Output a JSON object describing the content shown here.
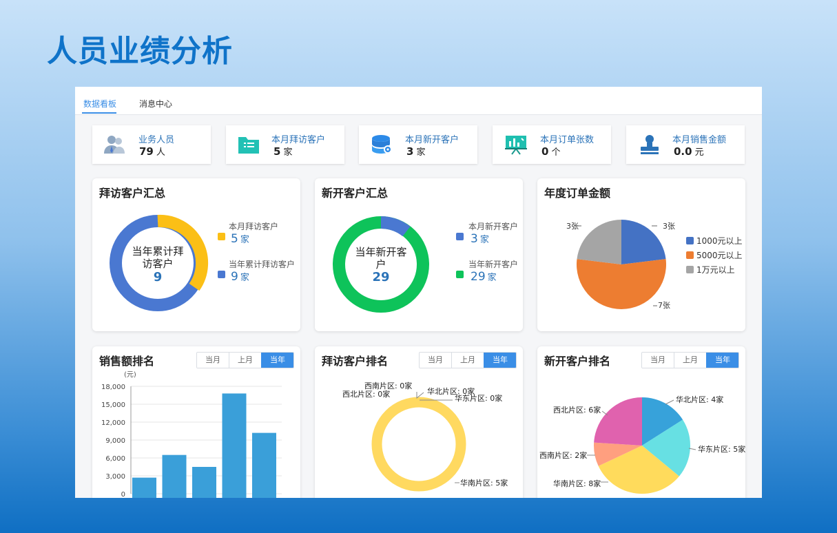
{
  "page": {
    "title": "人员业绩分析"
  },
  "tabs": [
    "数据看板",
    "消息中心"
  ],
  "stats": [
    {
      "label": "业务人员",
      "value": "79",
      "unit": "人",
      "icon": "users-icon"
    },
    {
      "label": "本月拜访客户",
      "value": "5",
      "unit": "家",
      "icon": "folder-list-icon"
    },
    {
      "label": "本月新开客户",
      "value": "3",
      "unit": "家",
      "icon": "database-gear-icon"
    },
    {
      "label": "本月订单张数",
      "value": "0",
      "unit": "个",
      "icon": "presentation-board-icon"
    },
    {
      "label": "本月销售金额",
      "value": "0.0",
      "unit": "元",
      "icon": "stamp-icon"
    }
  ],
  "cards": {
    "visit": {
      "title": "拜访客户汇总",
      "center_label": "当年累计拜访客户",
      "center_value": "9",
      "legend": [
        {
          "label": "本月拜访客户",
          "value": "5",
          "unit": "家",
          "color": "#fbbf16"
        },
        {
          "label": "当年累计拜访客户",
          "value": "9",
          "unit": "家",
          "color": "#4a78d1"
        }
      ]
    },
    "newcust": {
      "title": "新开客户汇总",
      "center_label": "当年新开客户",
      "center_value": "29",
      "legend": [
        {
          "label": "本月新开客户",
          "value": "3",
          "unit": "家",
          "color": "#4a78d1"
        },
        {
          "label": "当年新开客户",
          "value": "29",
          "unit": "家",
          "color": "#0ec35a"
        }
      ]
    },
    "orders": {
      "title": "年度订单金额"
    },
    "sales_rank": {
      "title": "销售额排名",
      "ylabel": "(元)"
    },
    "visit_rank": {
      "title": "拜访客户排名"
    },
    "new_rank": {
      "title": "新开客户排名"
    }
  },
  "segments": [
    "当月",
    "上月",
    "当年"
  ],
  "segment_active": "当年",
  "chart_data": [
    {
      "type": "pie",
      "title": "年度订单金额",
      "categories": [
        "1000元以上",
        "5000元以上",
        "1万元以上"
      ],
      "values": [
        3,
        7,
        3
      ],
      "value_labels": [
        "3张",
        "7张",
        "3张"
      ],
      "colors": [
        "#4472c4",
        "#ed7d31",
        "#a5a5a5"
      ],
      "legend": "right"
    },
    {
      "type": "bar",
      "title": "销售额排名",
      "ylabel": "(元)",
      "values": [
        2700,
        6500,
        4500,
        16800,
        10200
      ],
      "ylim": [
        0,
        18000
      ],
      "yticks": [
        "0",
        "3,000",
        "6,000",
        "9,000",
        "12,000",
        "15,000",
        "18,000"
      ],
      "color": "#3a9fd9"
    },
    {
      "type": "pie",
      "title": "拜访客户排名",
      "categories": [
        "华北片区: 0家",
        "华东片区: 0家",
        "华南片区: 5家",
        "西北片区: 0家",
        "西南片区: 0家"
      ],
      "values": [
        0,
        0,
        5,
        0,
        0
      ],
      "colors": [
        "#3ba1e0",
        "#5fd8e0",
        "#ffd960",
        "#ff9f7f",
        "#e062ae"
      ]
    },
    {
      "type": "pie",
      "title": "新开客户排名",
      "categories": [
        "华北片区: 4家",
        "华东片区: 5家",
        "华南片区: 8家",
        "西南片区: 2家",
        "西北片区: 6家"
      ],
      "values": [
        4,
        5,
        8,
        2,
        6
      ],
      "colors": [
        "#37a2da",
        "#67e0e3",
        "#ffdb5c",
        "#ff9f7f",
        "#e062ae"
      ]
    }
  ]
}
